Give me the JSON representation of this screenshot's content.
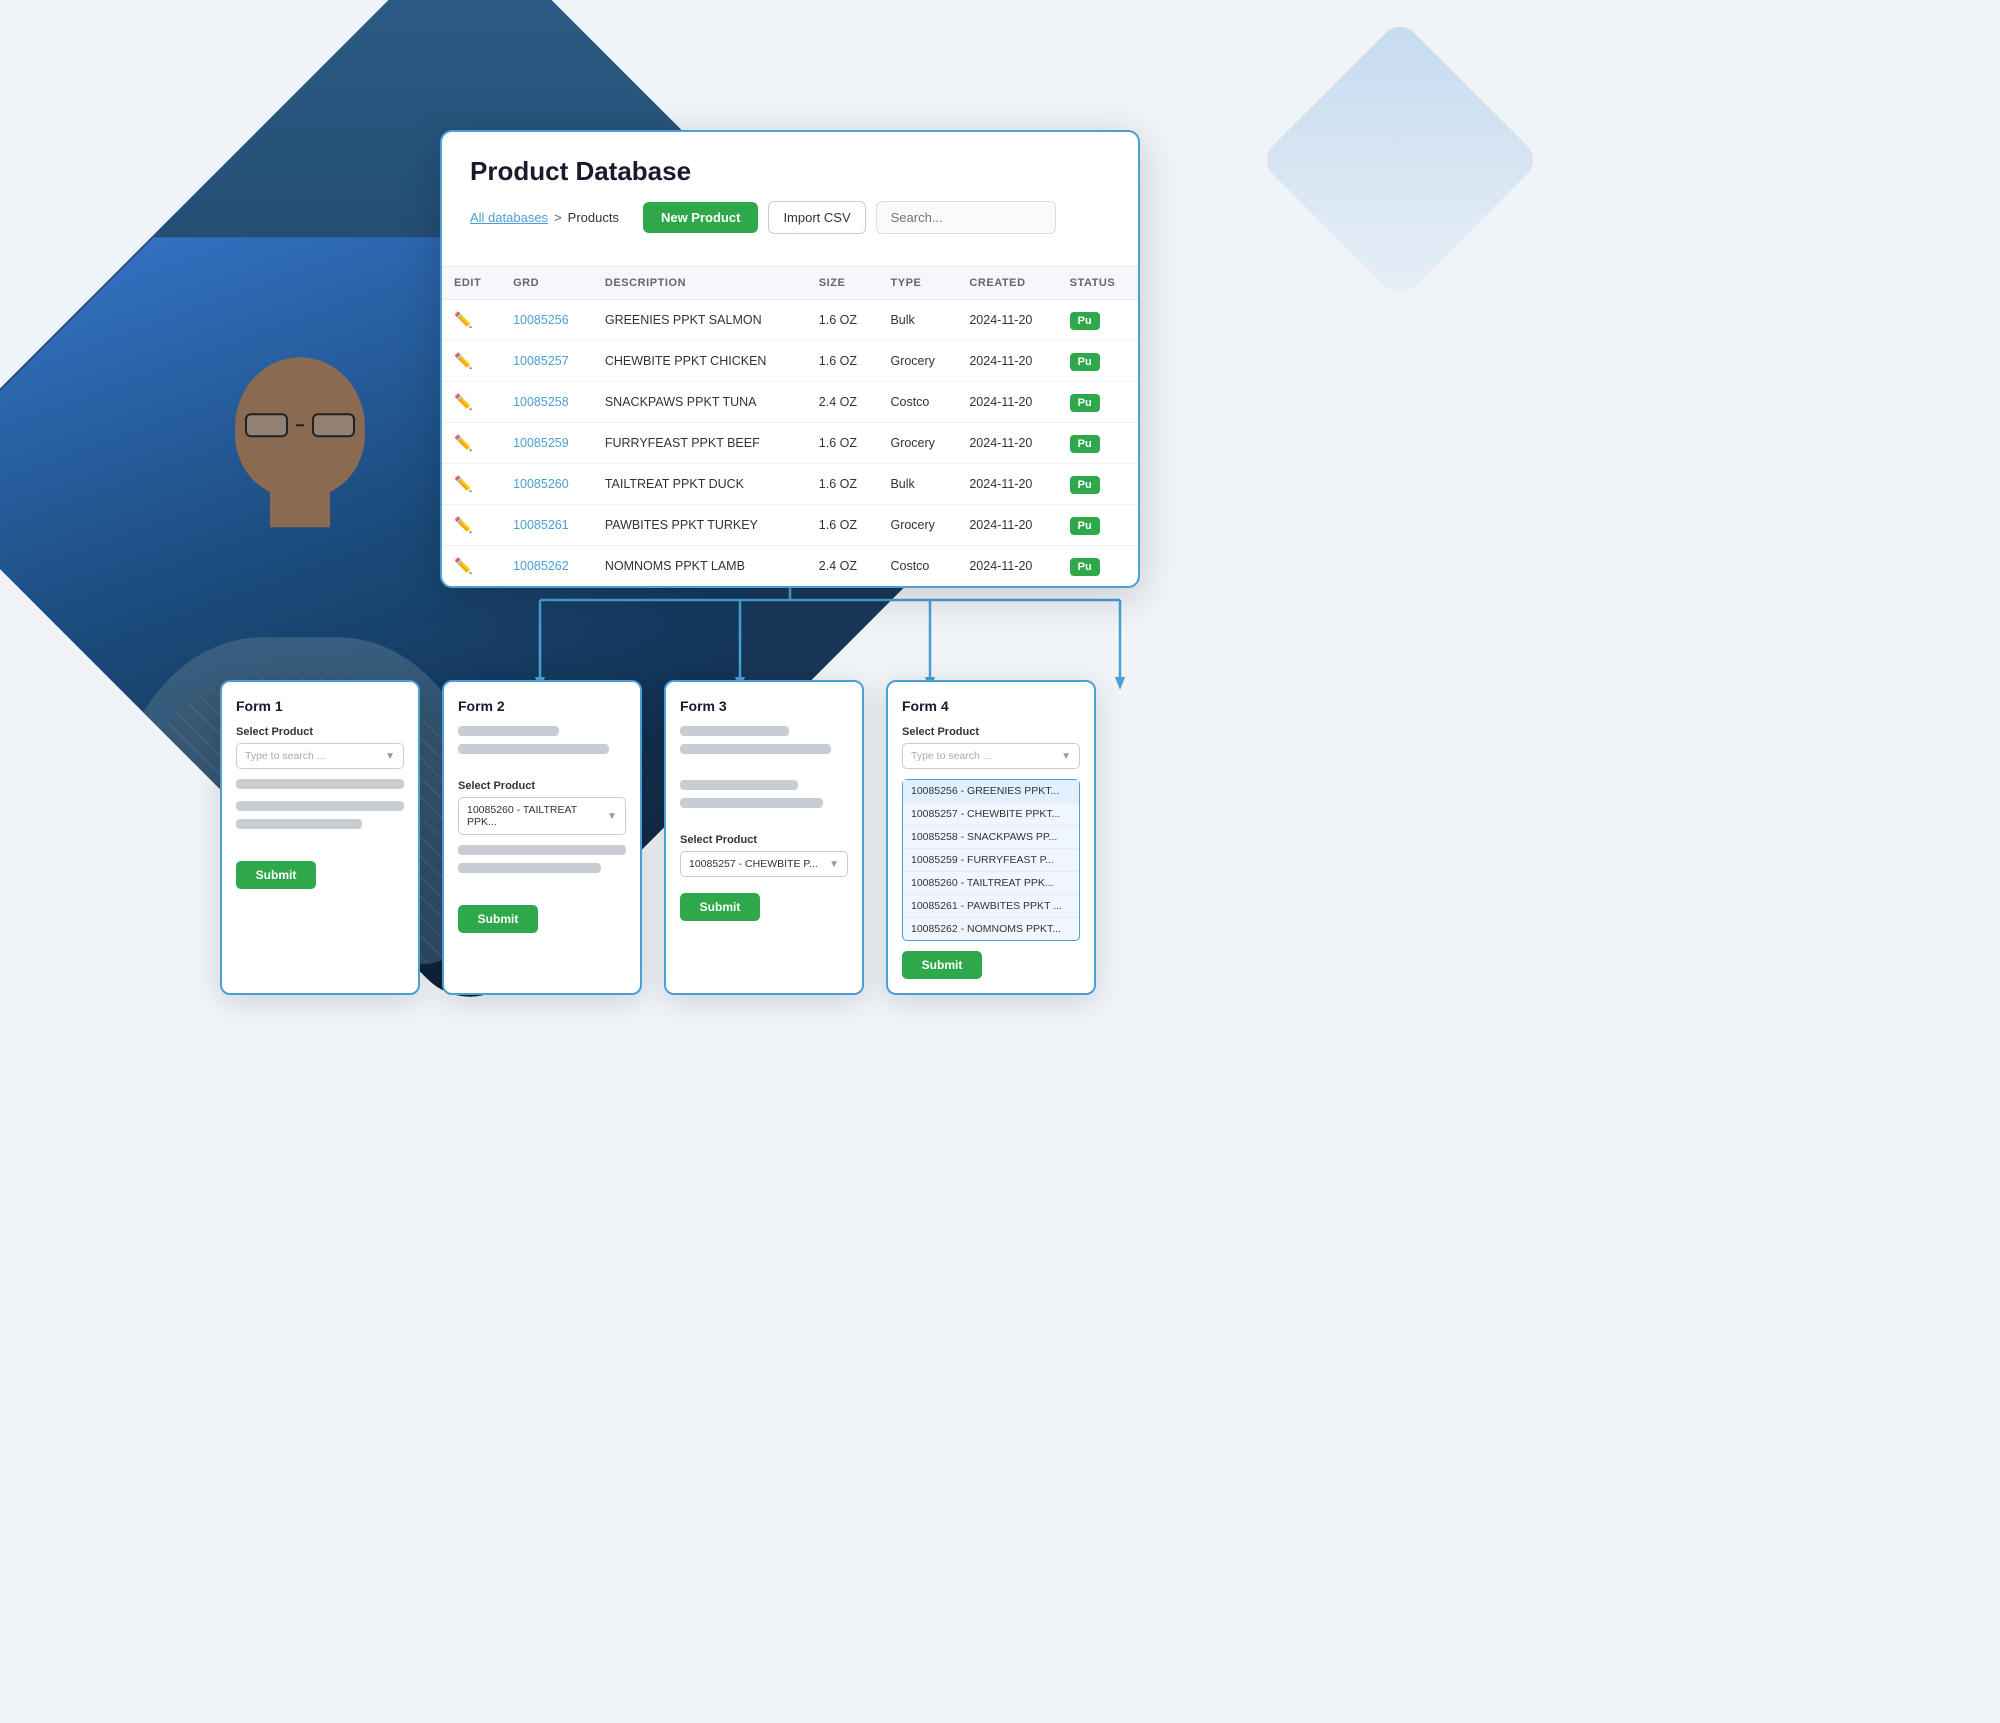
{
  "page": {
    "title": "Product Database"
  },
  "breadcrumb": {
    "all_databases": "All databases",
    "separator": ">",
    "current": "Products"
  },
  "toolbar": {
    "new_product_label": "New Product",
    "import_csv_label": "Import CSV",
    "search_placeholder": "Search..."
  },
  "table": {
    "headers": [
      "EDIT",
      "GRD",
      "DESCRIPTION",
      "SIZE",
      "TYPE",
      "CREATED",
      "STATUS"
    ],
    "rows": [
      {
        "grd": "10085256",
        "description": "GREENIES PPKT SALMON",
        "size": "1.6 OZ",
        "type": "Bulk",
        "created": "2024-11-20",
        "status": "Pu"
      },
      {
        "grd": "10085257",
        "description": "CHEWBITE PPKT CHICKEN",
        "size": "1.6 OZ",
        "type": "Grocery",
        "created": "2024-11-20",
        "status": "Pu"
      },
      {
        "grd": "10085258",
        "description": "SNACKPAWS PPKT TUNA",
        "size": "2.4 OZ",
        "type": "Costco",
        "created": "2024-11-20",
        "status": "Pu"
      },
      {
        "grd": "10085259",
        "description": "FURRYFEAST PPKT BEEF",
        "size": "1.6 OZ",
        "type": "Grocery",
        "created": "2024-11-20",
        "status": "Pu"
      },
      {
        "grd": "10085260",
        "description": "TAILTREAT PPKT DUCK",
        "size": "1.6 OZ",
        "type": "Bulk",
        "created": "2024-11-20",
        "status": "Pu"
      },
      {
        "grd": "10085261",
        "description": "PAWBITES PPKT TURKEY",
        "size": "1.6 OZ",
        "type": "Grocery",
        "created": "2024-11-20",
        "status": "Pu"
      },
      {
        "grd": "10085262",
        "description": "NOMNOMS PPKT LAMB",
        "size": "2.4 OZ",
        "type": "Costco",
        "created": "2024-11-20",
        "status": "Pu"
      }
    ]
  },
  "forms": {
    "form1": {
      "title": "Form 1",
      "select_label": "Select Product",
      "select_placeholder": "Type to search ...",
      "submit_label": "Submit"
    },
    "form2": {
      "title": "Form 2",
      "select_label": "Select Product",
      "selected_value": "10085260 - TAILTREAT PPK...",
      "submit_label": "Submit"
    },
    "form3": {
      "title": "Form 3",
      "select_label": "Select Product",
      "selected_value": "10085257 - CHEWBITE P...",
      "submit_label": "Submit"
    },
    "form4": {
      "title": "Form 4",
      "select_label": "Select Product",
      "select_placeholder": "Type to search ...",
      "dropdown_items": [
        "10085256 - GREENIES PPKT...",
        "10085257 - CHEWBITE PPKT...",
        "10085258 - SNACKPAWS PP...",
        "10085259 - FURRYFEAST P...",
        "10085260 - TAILTREAT PPK...",
        "10085261 - PAWBITES PPKT ...",
        "10085262 - NOMNOMS PPKT..."
      ],
      "submit_label": "Submit"
    }
  },
  "colors": {
    "accent_blue": "#4a9fd4",
    "green": "#2ea84a",
    "orange": "#e8a020",
    "dark_navy": "#1a3a5c"
  }
}
